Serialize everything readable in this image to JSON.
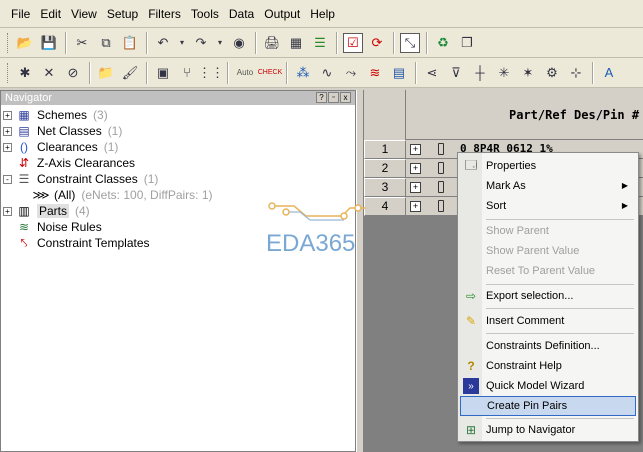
{
  "menu": [
    "File",
    "Edit",
    "View",
    "Setup",
    "Filters",
    "Tools",
    "Data",
    "Output",
    "Help"
  ],
  "toolbar1": {
    "icons": [
      "open-folder-icon",
      "save-icon",
      "cut-icon",
      "copy-icon",
      "paste-icon",
      "undo-icon",
      "redo-icon",
      "find-icon",
      "print-icon",
      "spreadsheet-icon",
      "layers-icon",
      "check-constraints-icon",
      "refresh-icon",
      "select-tool-icon",
      "recycle-icon",
      "copy-sheet-icon"
    ]
  },
  "toolbar2": {
    "auto_label": "Auto",
    "check_label": "CHECK"
  },
  "navigator": {
    "title": "Navigator",
    "buttons": [
      "?",
      "x"
    ],
    "items": [
      {
        "label": "Schemes",
        "count": "(3)",
        "expander": "+"
      },
      {
        "label": "Net Classes",
        "count": "(1)",
        "expander": "+"
      },
      {
        "label": "Clearances",
        "count": "(1)",
        "expander": "+"
      },
      {
        "label": "Z-Axis Clearances",
        "count": "",
        "expander": ""
      },
      {
        "label": "Constraint Classes",
        "count": "(1)",
        "expander": "-"
      },
      {
        "label": "(All)",
        "count": "(eNets: 100, DiffPairs: 1)",
        "expander": ""
      },
      {
        "label": "Parts",
        "count": "(4)",
        "expander": "+"
      },
      {
        "label": "Noise Rules",
        "count": "",
        "expander": ""
      },
      {
        "label": "Constraint Templates",
        "count": "",
        "expander": ""
      }
    ]
  },
  "grid": {
    "column_title": "Part/Ref Des/Pin #",
    "rows": [
      {
        "num": "1",
        "text": "0 8P4R 0612 1%"
      },
      {
        "num": "2",
        "text": ""
      },
      {
        "num": "3",
        "text": ""
      },
      {
        "num": "4",
        "text": ""
      }
    ]
  },
  "context_menu": {
    "items": [
      {
        "label": "Properties",
        "icon": "properties-icon",
        "enabled": true,
        "submenu": false
      },
      {
        "label": "Mark As",
        "icon": "",
        "enabled": true,
        "submenu": true
      },
      {
        "label": "Sort",
        "icon": "",
        "enabled": true,
        "submenu": true
      },
      {
        "label": "Show Parent",
        "icon": "",
        "enabled": false,
        "submenu": false
      },
      {
        "label": "Show Parent Value",
        "icon": "",
        "enabled": false,
        "submenu": false
      },
      {
        "label": "Reset To Parent Value",
        "icon": "",
        "enabled": false,
        "submenu": false
      },
      {
        "label": "Export selection...",
        "icon": "export-icon",
        "enabled": true,
        "submenu": false
      },
      {
        "label": "Insert Comment",
        "icon": "comment-icon",
        "enabled": true,
        "submenu": false
      },
      {
        "label": "Constraints Definition...",
        "icon": "",
        "enabled": true,
        "submenu": false
      },
      {
        "label": "Constraint Help",
        "icon": "help-icon",
        "enabled": true,
        "submenu": false
      },
      {
        "label": "Quick Model Wizard",
        "icon": "wizard-icon",
        "enabled": true,
        "submenu": false
      },
      {
        "label": "Create Pin Pairs",
        "icon": "",
        "enabled": true,
        "submenu": false
      },
      {
        "label": "Jump to Navigator",
        "icon": "navigator-icon",
        "enabled": true,
        "submenu": false
      }
    ]
  },
  "watermark": {
    "text": "EDA365",
    "color": "#79a8d4"
  }
}
